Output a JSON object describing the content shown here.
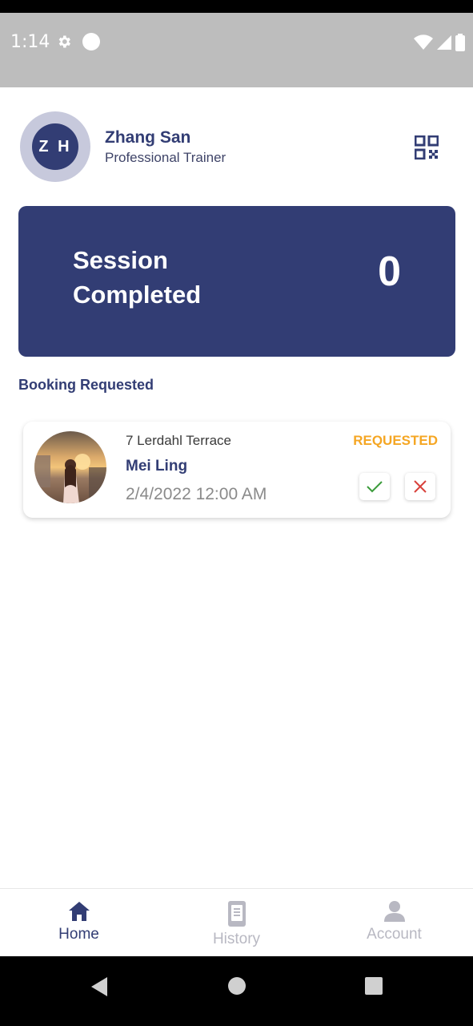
{
  "status_bar": {
    "time": "1:14"
  },
  "profile": {
    "initials": "Z H",
    "name": "Zhang San",
    "role": "Professional Trainer"
  },
  "session_card": {
    "label": "Session Completed",
    "count": "0"
  },
  "booking_section": {
    "title": "Booking Requested"
  },
  "booking": {
    "address": "7 Lerdahl Terrace",
    "name": "Mei Ling",
    "datetime": "2/4/2022 12:00 AM",
    "status": "REQUESTED",
    "status_color": "#f5a623"
  },
  "bottom_nav": {
    "items": [
      {
        "label": "Home",
        "icon": "home-icon",
        "active": true
      },
      {
        "label": "History",
        "icon": "history-icon",
        "active": false
      },
      {
        "label": "Account",
        "icon": "account-icon",
        "active": false
      }
    ]
  },
  "colors": {
    "primary": "#323d74",
    "accept": "#3a9b3a",
    "reject": "#d8413b"
  }
}
